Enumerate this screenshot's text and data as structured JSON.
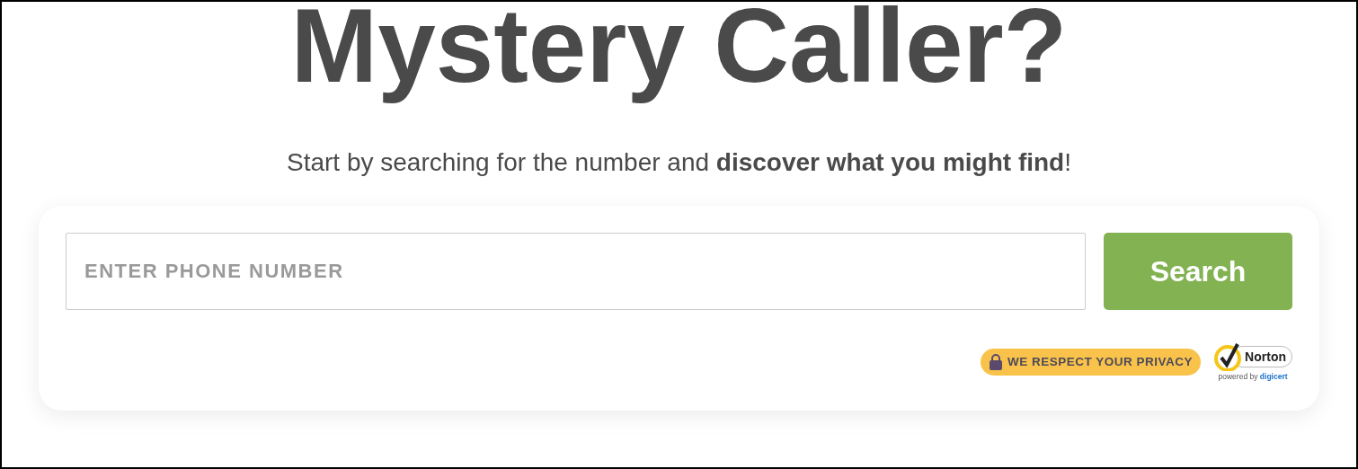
{
  "heading": "Mystery Caller?",
  "subtitle": "Start by searching for the number and **discover what you might find**!",
  "search": {
    "placeholder": "ENTER PHONE NUMBER",
    "button": "Search"
  },
  "privacy_badge": "WE RESPECT YOUR PRIVACY",
  "seal": {
    "name": "Norton",
    "powered_by": "powered by",
    "brand": "digicert"
  }
}
